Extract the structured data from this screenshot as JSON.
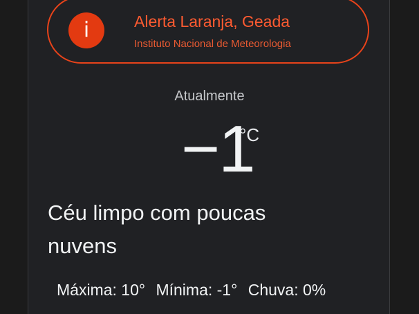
{
  "alert": {
    "icon": "info-icon",
    "icon_glyph": "i",
    "title": "Alerta Laranja, Geada",
    "source": "Instituto Nacional de Meteorologia",
    "accent_color": "#e8431a"
  },
  "current": {
    "label": "Atualmente",
    "temperature": "−1",
    "unit": "°C",
    "condition": "Céu limpo com poucas nuvens"
  },
  "stats": {
    "max": "Máxima: 10°",
    "min": "Mínima: -1°",
    "rain": "Chuva: 0%"
  }
}
